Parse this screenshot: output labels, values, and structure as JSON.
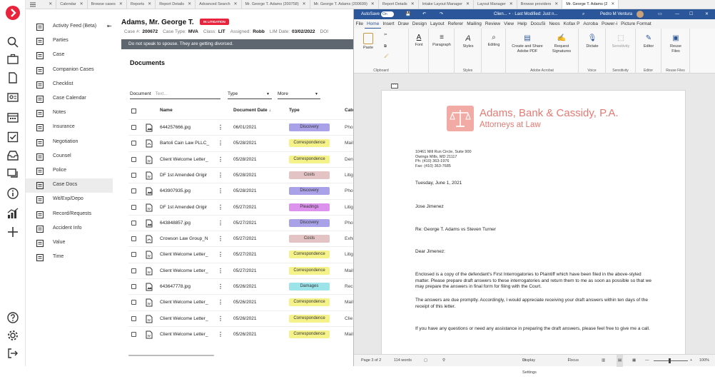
{
  "tabs": [
    {
      "label": "",
      "active": false
    },
    {
      "label": "Calendar",
      "active": false
    },
    {
      "label": "Browse cases",
      "active": false
    },
    {
      "label": "Reports",
      "active": false
    },
    {
      "label": "Report Details",
      "active": false
    },
    {
      "label": "Advanced Search",
      "active": false
    },
    {
      "label": "Mr. George T. Adams (200758)",
      "active": false
    },
    {
      "label": "Mr. George T. Adams (200699)",
      "active": false
    },
    {
      "label": "Report Details",
      "active": false
    },
    {
      "label": "Intake Layout Manager",
      "active": false
    },
    {
      "label": "Layout Manager",
      "active": false
    },
    {
      "label": "Browse providers",
      "active": false
    },
    {
      "label": "Mr. George T. Adams (2",
      "active": true
    }
  ],
  "tab_close": "✕",
  "sidebar": [
    {
      "label": "Activity Feed (Beta)",
      "icon": "activity-feed-icon"
    },
    {
      "label": "Parties",
      "icon": "parties-icon"
    },
    {
      "label": "Case",
      "icon": "case-icon"
    },
    {
      "label": "Companion Cases",
      "icon": "companion-cases-icon"
    },
    {
      "label": "Checklist",
      "icon": "checklist-icon"
    },
    {
      "label": "Case Calendar",
      "icon": "case-calendar-icon"
    },
    {
      "label": "Notes",
      "icon": "notes-icon"
    },
    {
      "label": "Insurance",
      "icon": "insurance-icon"
    },
    {
      "label": "Negotiation",
      "icon": "negotiation-icon"
    },
    {
      "label": "Counsel",
      "icon": "counsel-icon"
    },
    {
      "label": "Police",
      "icon": "police-icon"
    },
    {
      "label": "Case Docs",
      "icon": "case-docs-icon",
      "active": true
    },
    {
      "label": "Wit/Exp/Depo",
      "icon": "wit-exp-depo-icon"
    },
    {
      "label": "Record/Requests",
      "icon": "record-requests-icon"
    },
    {
      "label": "Accident Info",
      "icon": "accident-info-icon"
    },
    {
      "label": "Value",
      "icon": "value-icon"
    },
    {
      "label": "Time",
      "icon": "time-icon"
    }
  ],
  "case": {
    "title": "Adams, Mr. George T.",
    "badge": "IN LITIGATION",
    "info": [
      {
        "label": "Case #:",
        "value": "200672"
      },
      {
        "label": "Case Type:",
        "value": "MVA"
      },
      {
        "label": "Class:",
        "value": "LIT"
      },
      {
        "label": "Assigned:",
        "value": "Robb"
      },
      {
        "label": "LIM Date:",
        "value": "03/02/2022"
      },
      {
        "label": "DOI",
        "value": ""
      }
    ],
    "banner": "Do not speak to spouse. They are getting divorced."
  },
  "documents": {
    "heading": "Documents",
    "filter_label": "Document",
    "filter_placeholder": "Text...",
    "type_select": "Type",
    "more_select": "More",
    "columns": {
      "name": "Name",
      "date": "Document Date ↓",
      "type": "Type",
      "category": "Cate"
    },
    "rows": [
      {
        "name": "644257666.jpg",
        "file": "jpg",
        "date": "06/01/2021",
        "type": "Discovery",
        "color": "#a9a2e8",
        "cat": "Pho"
      },
      {
        "name": "Bartoli Cain Law PLLC_",
        "file": "pdf",
        "date": "05/28/2021",
        "type": "Correspondence",
        "color": "#f6f28a",
        "cat": "Mail"
      },
      {
        "name": "Client Welcome Letter_",
        "file": "doc",
        "date": "05/28/2021",
        "type": "Correspondence",
        "color": "#f6f28a",
        "cat": "Den"
      },
      {
        "name": "DF 1st Amended Origir",
        "file": "doc",
        "date": "05/28/2021",
        "type": "Costs",
        "color": "#e3c3c3",
        "cat": "Litig"
      },
      {
        "name": "643907935.jpg",
        "file": "jpg",
        "date": "05/28/2021",
        "type": "Discovery",
        "color": "#a9a2e8",
        "cat": "Pho"
      },
      {
        "name": "DF 1st Amended Origir",
        "file": "doc",
        "date": "05/27/2021",
        "type": "Pleadings",
        "color": "#dd93ee",
        "cat": "Litig"
      },
      {
        "name": "643848857.jpg",
        "file": "jpg",
        "date": "05/27/2021",
        "type": "Discovery",
        "color": "#a9a2e8",
        "cat": "Pho"
      },
      {
        "name": "Crowson Law Group_N",
        "file": "pdf",
        "date": "05/27/2021",
        "type": "Costs",
        "color": "#e3c3c3",
        "cat": "Exhi"
      },
      {
        "name": "Client Welcome Letter_",
        "file": "doc",
        "date": "05/27/2021",
        "type": "Correspondence",
        "color": "#f6f28a",
        "cat": "Litig"
      },
      {
        "name": "Client Welcome Letter_",
        "file": "doc",
        "date": "05/27/2021",
        "type": "Correspondence",
        "color": "#f6f28a",
        "cat": "Mail"
      },
      {
        "name": "643647778.jpg",
        "file": "jpg",
        "date": "05/26/2021",
        "type": "Damages",
        "color": "#9de3ea",
        "cat": "Rec"
      },
      {
        "name": "Client Welcome Letter_",
        "file": "doc",
        "date": "05/26/2021",
        "type": "Correspondence",
        "color": "#f6f28a",
        "cat": "Mail"
      },
      {
        "name": "Client Welcome Letter_",
        "file": "doc",
        "date": "05/26/2021",
        "type": "Correspondence",
        "color": "#f6f28a",
        "cat": "Clie"
      },
      {
        "name": "Client Welcome Letter_",
        "file": "doc",
        "date": "05/26/2021",
        "type": "Correspondence",
        "color": "#f6f28a",
        "cat": "Mail"
      }
    ]
  },
  "word": {
    "autosave": "AutoSave",
    "autosave_state": "On",
    "doc_title": "Clien... ∘ · Last Modified: Just n...",
    "user": "Pedro M Ventura",
    "menu": [
      "File",
      "Home",
      "Insert",
      "Draw",
      "Design",
      "Layout",
      "Referer",
      "Mailing",
      "Review",
      "View",
      "Help",
      "DocuSi",
      "Neos",
      "Kofax P",
      "Acroba",
      "Power-i",
      "Picture Format"
    ],
    "active_menu": "Home",
    "ribbon": {
      "paste": "Paste",
      "font": "Font",
      "paragraph": "Paragraph",
      "styles": "Styles",
      "editing": "Editing",
      "create_pdf": "Create and Share Adobe PDF",
      "request_sig": "Request Signatures",
      "dictate": "Dictate",
      "sensitivity": "Sensitivity",
      "editor": "Editor",
      "reuse": "Reuse Files",
      "groups": [
        "Clipboard",
        "Styles",
        "Adobe Acrobat",
        "Voice",
        "Sensitivity",
        "Editor",
        "Reuse Files"
      ]
    },
    "letter": {
      "firm": "Adams, Bank & Cassidy, P.A.",
      "tagline": "Attorneys at Law",
      "address": [
        "10461 Mill Run Circle, Suite 900",
        "Owings Mills, MD 21117",
        "Ph: (410) 363-1976",
        "Fax: (410) 363-7685"
      ],
      "date": "Tuesday, June 1, 2021",
      "recipient": "Jose Jimenez",
      "re": "Re: George T. Adams vs Steven Turner",
      "salutation": "Dear  Jimenez:",
      "p1": "Enclosed is a copy of the defendant's First Interrogatories to Plaintiff which have been filed in the above-styled matter.  Please prepare draft answers to these interrogatories and return them to me as soon as possible so that we may prepare the answers in final form for filing with the Court.",
      "p2": "The answers are due promptly.  Accordingly, I would appreciate receiving your draft answers within ten days of the receipt of this letter.",
      "p3": "If you have any questions or need any assistance in preparing the draft answers, please feel free to give me a call."
    },
    "status": {
      "page": "Page 3 of 2",
      "words": "114 words",
      "display": "Display Settings",
      "focus": "Focus",
      "zoom": "100%"
    }
  },
  "colors": {
    "brand": "#e8233b",
    "word_blue": "#2b579a",
    "banner": "#5e6670"
  }
}
